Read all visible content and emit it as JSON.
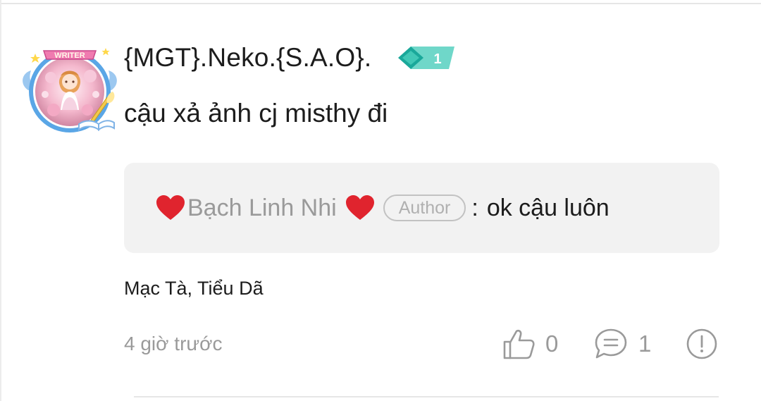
{
  "comment": {
    "username": "{MGT}.Neko.{S.A.O}.",
    "avatar_frame_label": "WRITER",
    "level": "1",
    "text": "cậu xả ảnh cj misthy đi",
    "reply": {
      "author": "Bạch Linh Nhi",
      "author_tag": "Author",
      "separator": ":",
      "text": "ok cậu luôn"
    },
    "liked_by": "Mạc Tà, Tiểu Dã",
    "timestamp": "4 giờ trước",
    "actions": {
      "like_count": "0",
      "reply_count": "1"
    }
  },
  "icons": {
    "level": "level-badge-icon",
    "heart": "heart-icon",
    "like": "thumbs-up-icon",
    "reply": "speech-bubble-icon",
    "report": "exclamation-circle-icon"
  },
  "colors": {
    "text": "#1c1c1c",
    "muted": "#9a9a9a",
    "reply_background": "#f2f2f2",
    "heart": "#e0242e",
    "badge": "#2ec4b0"
  }
}
